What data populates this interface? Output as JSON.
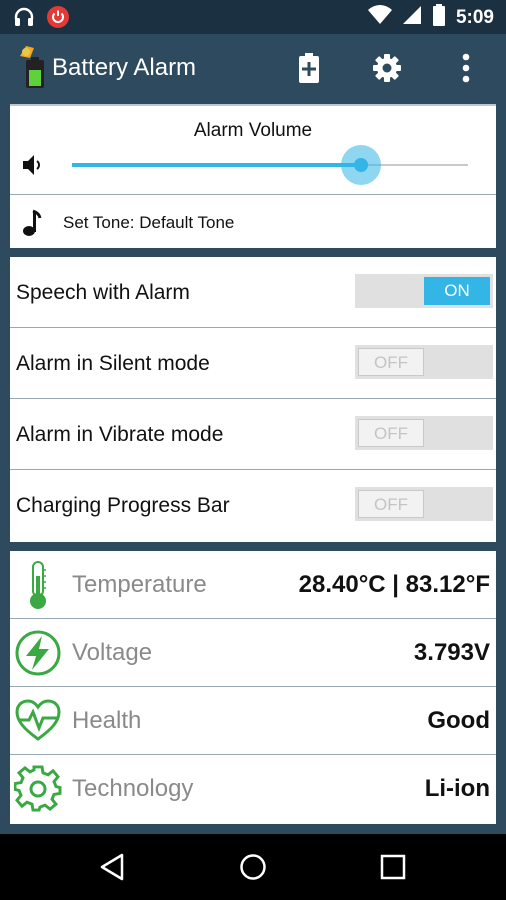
{
  "status_bar": {
    "time": "5:09"
  },
  "app_bar": {
    "title": "Battery Alarm"
  },
  "alarm": {
    "volume_label": "Alarm Volume",
    "volume_level": 0.73,
    "tone_text": "Set Tone: Default Tone"
  },
  "settings": [
    {
      "label": "Speech with Alarm",
      "state": "ON"
    },
    {
      "label": "Alarm in Silent mode",
      "state": "OFF"
    },
    {
      "label": "Alarm in Vibrate mode",
      "state": "OFF"
    },
    {
      "label": "Charging Progress Bar",
      "state": "OFF"
    }
  ],
  "battery_info": [
    {
      "label": "Temperature",
      "value": "28.40°C | 83.12°F",
      "icon": "thermometer-icon"
    },
    {
      "label": "Voltage",
      "value": "3.793V",
      "icon": "voltage-bolt-icon"
    },
    {
      "label": "Health",
      "value": "Good",
      "icon": "health-heart-icon"
    },
    {
      "label": "Technology",
      "value": "Li-ion",
      "icon": "technology-gear-icon"
    }
  ],
  "colors": {
    "accent": "#33b5e5",
    "green": "#3aa843",
    "appbar": "#2e4a5e",
    "statusbar": "#1b3142"
  }
}
